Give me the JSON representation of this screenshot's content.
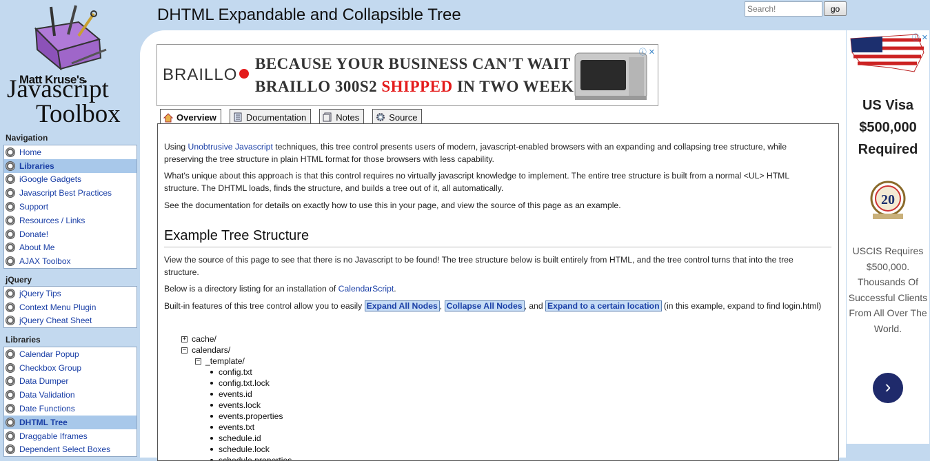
{
  "header": {
    "title": "DHTML Expandable and Collapsible Tree",
    "search_placeholder": "Search!",
    "go_label": "go"
  },
  "logo": {
    "line1": "Matt Kruse's",
    "line2": "Javascript",
    "line3": "Toolbox"
  },
  "sidebar": {
    "navigation": {
      "heading": "Navigation",
      "items": [
        {
          "label": "Home",
          "active": false
        },
        {
          "label": "Libraries",
          "active": true
        },
        {
          "label": "iGoogle Gadgets",
          "active": false
        },
        {
          "label": "Javascript Best Practices",
          "active": false
        },
        {
          "label": "Support",
          "active": false
        },
        {
          "label": "Resources / Links",
          "active": false
        },
        {
          "label": "Donate!",
          "active": false
        },
        {
          "label": "About Me",
          "active": false
        },
        {
          "label": "AJAX Toolbox",
          "active": false
        }
      ]
    },
    "jquery": {
      "heading": "jQuery",
      "items": [
        {
          "label": "jQuery Tips"
        },
        {
          "label": "Context Menu Plugin"
        },
        {
          "label": "jQuery Cheat Sheet"
        }
      ]
    },
    "libraries": {
      "heading": "Libraries",
      "items": [
        {
          "label": "Calendar Popup",
          "active": false
        },
        {
          "label": "Checkbox Group",
          "active": false
        },
        {
          "label": "Data Dumper",
          "active": false
        },
        {
          "label": "Data Validation",
          "active": false
        },
        {
          "label": "Date Functions",
          "active": false
        },
        {
          "label": "DHTML Tree",
          "active": true
        },
        {
          "label": "Draggable Iframes",
          "active": false
        },
        {
          "label": "Dependent Select Boxes",
          "active": false
        }
      ]
    }
  },
  "ad_banner": {
    "brand": "BRAILLO",
    "line1": "BECAUSE YOUR BUSINESS CAN'T WAIT",
    "line2_a": "BRAILLO 300S2 ",
    "line2_b": "SHIPPED",
    "line2_c": " IN TWO WEEKS",
    "info": "ⓘ ✕"
  },
  "tabs": [
    "Overview",
    "Documentation",
    "Notes",
    "Source"
  ],
  "content": {
    "p1_a": "Using ",
    "p1_link": "Unobtrusive Javascript",
    "p1_b": " techniques, this tree control presents users of modern, javascript-enabled browsers with an expanding and collapsing tree structure, while preserving the tree structure in plain HTML format for those browsers with less capability.",
    "p2": "What's unique about this approach is that this control requires no virtually javascript knowledge to implement. The entire tree structure is built from a normal <UL> HTML structure. The DHTML loads, finds the structure, and builds a tree out of it, all automatically.",
    "p3": "See the documentation for details on exactly how to use this in your page, and view the source of this page as an example.",
    "heading": "Example Tree Structure",
    "p4": "View the source of this page to see that there is no Javascript to be found! The tree structure below is built entirely from HTML, and the tree control turns that into the tree structure.",
    "p5_a": "Below is a directory listing for an installation of ",
    "p5_link": "CalendarScript",
    "p5_b": ".",
    "p6_a": "Built-in features of this tree control allow you to easily ",
    "btn_expand": "Expand All Nodes",
    "p6_sep": ", ",
    "btn_collapse": "Collapse All Nodes",
    "p6_and": ", and ",
    "btn_location": "Expand to a certain location",
    "p6_b": " (in this example, expand to find login.html)"
  },
  "tree": {
    "cache": "cache/",
    "calendars": "calendars/",
    "template": "_template/",
    "files": [
      "config.txt",
      "config.txt.lock",
      "events.id",
      "events.lock",
      "events.properties",
      "events.txt",
      "schedule.id",
      "schedule.lock",
      "schedule.properties"
    ]
  },
  "right_ad": {
    "line1": "US Visa",
    "line2": "$500,000",
    "line3": "Required",
    "badge": "20",
    "body": "USCIS Requires $500,000. Thousands Of Successful Clients From All Over The World.",
    "info": "ⓘ ✕"
  }
}
